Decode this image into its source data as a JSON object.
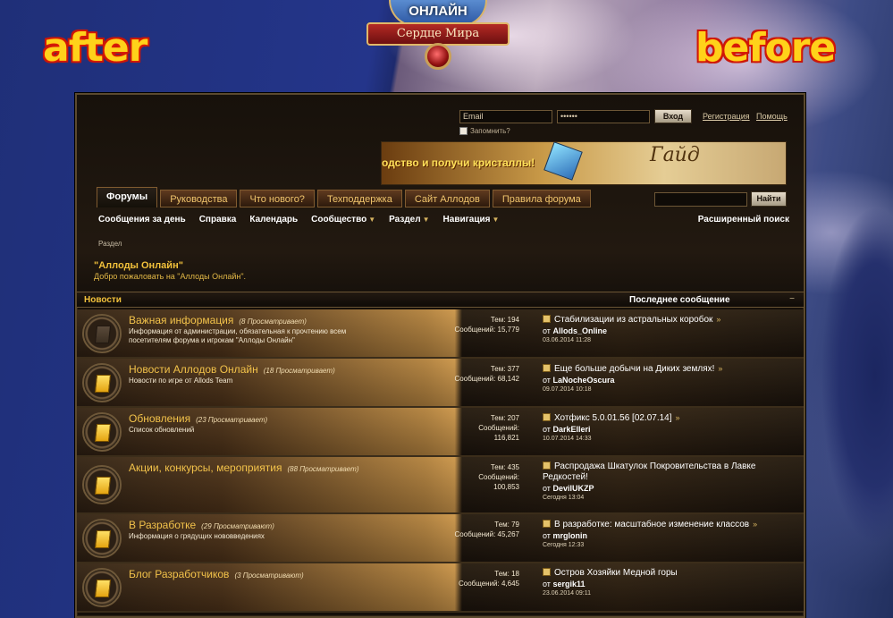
{
  "labels": {
    "after": "after",
    "before": "before"
  },
  "logo": {
    "title": "ОНЛАЙН",
    "subtitle": "Сердце Мира"
  },
  "login": {
    "email_value": "Email",
    "password_value": "••••••",
    "login_button": "Вход",
    "register_link": "Регистрация",
    "help_link": "Помощь",
    "remember_label": "Запомнить?"
  },
  "banner": {
    "slogan": "одство и получи кристаллы!",
    "guide": "Гайд"
  },
  "tabs": [
    "Форумы",
    "Руководства",
    "Что нового?",
    "Техподдержка",
    "Сайт Аллодов",
    "Правила форума"
  ],
  "search": {
    "button": "Найти",
    "advanced": "Расширенный поиск"
  },
  "subnav": [
    {
      "label": "Сообщения за день",
      "dropdown": false
    },
    {
      "label": "Справка",
      "dropdown": false
    },
    {
      "label": "Календарь",
      "dropdown": false
    },
    {
      "label": "Сообщество",
      "dropdown": true
    },
    {
      "label": "Раздел",
      "dropdown": true
    },
    {
      "label": "Навигация",
      "dropdown": true
    }
  ],
  "breadcrumb": "Раздел",
  "forum": {
    "title": "\"Аллоды Онлайн\"",
    "welcome": "Добро пожаловать на \"Аллоды Онлайн\"."
  },
  "category": {
    "name": "Новости",
    "last_post_header": "Последнее сообщение",
    "collapse": "−"
  },
  "rows": [
    {
      "name": "Важная информация",
      "viewers": "(8 Просматривает)",
      "desc": "Информация от администрации, обязательная к прочтению всем посетителям форума и игрокам \"Аллоды Онлайн\"",
      "topics": "Тем: 194",
      "posts": "Сообщений: 15,779",
      "last_title": "Стабилизации из астральных коробок",
      "last_by_prefix": "от",
      "last_by": "Allods_Online",
      "last_date": "03.06.2014 11:28",
      "icon_state": "gray"
    },
    {
      "name": "Новости Аллодов Онлайн",
      "viewers": "(18 Просматривает)",
      "desc": "Новости по игре от Allods Team",
      "topics": "Тем: 377",
      "posts": "Сообщений: 68,142",
      "last_title": "Еще больше добычи на Диких землях!",
      "last_by_prefix": "от",
      "last_by": "LaNocheOscura",
      "last_date": "09.07.2014 10:18",
      "icon_state": "gold"
    },
    {
      "name": "Обновления",
      "viewers": "(23 Просматривает)",
      "desc": "Список обновлений",
      "topics": "Тем: 207",
      "posts": "Сообщений:",
      "posts2": "116,821",
      "last_title": "Хотфикс 5.0.01.56 [02.07.14]",
      "last_by_prefix": "от",
      "last_by": "DarkElleri",
      "last_date": "10.07.2014 14:33",
      "icon_state": "gold"
    },
    {
      "name": "Акции, конкурсы, мероприятия",
      "viewers": "(88 Просматривает)",
      "desc": "",
      "topics": "Тем: 435",
      "posts": "Сообщений:",
      "posts2": "100,853",
      "last_title": "Распродажа Шкатулок Покровительства в Лавке Редкостей!",
      "last_by_prefix": "от",
      "last_by": "DevilUKZP",
      "last_date": "Сегодня 13:04",
      "icon_state": "gold"
    },
    {
      "name": "В Разработке",
      "viewers": "(29 Просматривают)",
      "desc": "Информация о грядущих нововведениях",
      "topics": "Тем: 79",
      "posts": "Сообщений: 45,267",
      "last_title": "В разработке: масштабное изменение классов",
      "last_by_prefix": "от",
      "last_by": "mrglonin",
      "last_date": "Сегодня 12:33",
      "icon_state": "gold"
    },
    {
      "name": "Блог Разработчиков",
      "viewers": "(3 Просматривают)",
      "desc": "",
      "topics": "Тем: 18",
      "posts": "Сообщений: 4,645",
      "last_title": "Остров Хозяйки Медной горы",
      "last_by_prefix": "от",
      "last_by": "sergik11",
      "last_date": "23.06.2014 09:11",
      "icon_state": "gold"
    }
  ],
  "colors": {
    "gold_text": "#f2c24a",
    "accent_red": "#c2140a",
    "frame_bg": "#150f09"
  }
}
